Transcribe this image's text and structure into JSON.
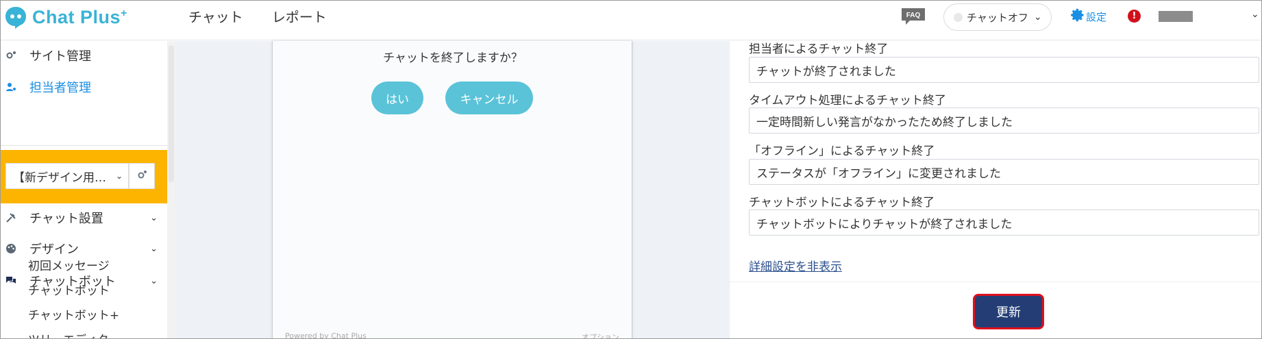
{
  "app": {
    "name": "Chat Plus",
    "name_sup": "+"
  },
  "header": {
    "nav": [
      {
        "label": "チャット"
      },
      {
        "label": "レポート"
      }
    ],
    "faq_label": "FAQ",
    "status": "チャットオフ",
    "settings_label": "設定",
    "alert_label": "!"
  },
  "sidebar": {
    "items": [
      {
        "label": "サイト管理",
        "icon": "gear-people-icon"
      },
      {
        "label": "担当者管理",
        "icon": "user-gear-icon",
        "color": "#1a8fe3"
      }
    ],
    "site_select": "【新デザイン用…",
    "sections": [
      {
        "label": "チャット設置",
        "icon": "tools-icon"
      },
      {
        "label": "デザイン",
        "icon": "palette-icon"
      },
      {
        "label": "チャットボット",
        "icon": "chat-bubbles-icon"
      }
    ],
    "sub_items": [
      "初回メッセージ",
      "チャットボット",
      "チャットボット+",
      "ツリーエディタ"
    ]
  },
  "preview": {
    "question": "チャットを終了しますか？",
    "yes_label": "はい",
    "cancel_label": "キャンセル",
    "powered": "Powered by Chat Plus",
    "option": "オプション"
  },
  "form": {
    "fields": [
      {
        "label": "担当者によるチャット終了",
        "value": "チャットが終了されました"
      },
      {
        "label": "タイムアウト処理によるチャット終了",
        "value": "一定時間新しい発言がなかったため終了しました"
      },
      {
        "label": "「オフライン」によるチャット終了",
        "value": "ステータスが「オフライン」に変更されました"
      },
      {
        "label": "チャットボットによるチャット終了",
        "value": "チャットボットによりチャットが終了されました"
      }
    ],
    "toggle_link": "詳細設定を非表示",
    "update_label": "更新"
  },
  "colors": {
    "brand": "#39b3d6",
    "accent_blue": "#1a8fe3",
    "highlight": "#fcb400",
    "button_dark": "#243e75",
    "button_border": "#e0101c",
    "pill": "#5ac3d8"
  }
}
